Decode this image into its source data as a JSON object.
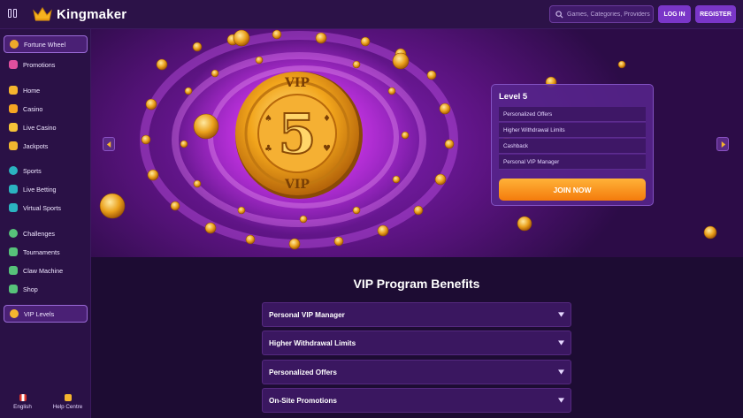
{
  "header": {
    "brand": "Kingmaker",
    "search_placeholder": "Games, Categories, Providers",
    "login_label": "LOG IN",
    "register_label": "REGISTER"
  },
  "sidebar": {
    "items": [
      {
        "label": "Fortune Wheel",
        "icon": "wheel-icon",
        "color": "#f0a92a"
      },
      {
        "label": "Promotions",
        "icon": "gift-icon",
        "color": "#e04f9e"
      },
      {
        "label": "Home",
        "icon": "home-icon",
        "color": "#f5b52e"
      },
      {
        "label": "Casino",
        "icon": "casino-icon",
        "color": "#f5a623"
      },
      {
        "label": "Live Casino",
        "icon": "live-casino-icon",
        "color": "#f6c338"
      },
      {
        "label": "Jackpots",
        "icon": "jackpot-icon",
        "color": "#f0b62f"
      },
      {
        "label": "Sports",
        "icon": "sports-icon",
        "color": "#2bb3c0"
      },
      {
        "label": "Live Betting",
        "icon": "live-betting-icon",
        "color": "#2bb3c0"
      },
      {
        "label": "Virtual Sports",
        "icon": "virtual-sports-icon",
        "color": "#2bb3c0"
      },
      {
        "label": "Challenges",
        "icon": "challenge-icon",
        "color": "#57c27a"
      },
      {
        "label": "Tournaments",
        "icon": "trophy-icon",
        "color": "#57c27a"
      },
      {
        "label": "Claw Machine",
        "icon": "claw-icon",
        "color": "#57c27a"
      },
      {
        "label": "Shop",
        "icon": "shop-icon",
        "color": "#57c27a"
      },
      {
        "label": "VIP Levels",
        "icon": "vip-icon",
        "color": "#f5b52e"
      }
    ],
    "footer": [
      {
        "label": "English",
        "icon": "canada-flag-icon",
        "color": "#d9342b"
      },
      {
        "label": "Help Centre",
        "icon": "help-icon",
        "color": "#f5b52e"
      }
    ]
  },
  "hero": {
    "coin_top_text": "VIP",
    "coin_number": "5",
    "coin_bottom_text": "VIP",
    "card_title": "Level 5",
    "perks": [
      "Personalized Offers",
      "Higher Withdrawal Limits",
      "Cashback",
      "Personal VIP Manager"
    ],
    "join_label": "JOIN NOW"
  },
  "main": {
    "title": "VIP Program Benefits",
    "accordion": [
      "Personal VIP Manager",
      "Higher Withdrawal Limits",
      "Personalized Offers",
      "On-Site Promotions"
    ]
  },
  "colors": {
    "accent": "#7a36c8",
    "gold": "#f0a92a",
    "join": "#f47b0c",
    "background": "#1d0c33"
  }
}
